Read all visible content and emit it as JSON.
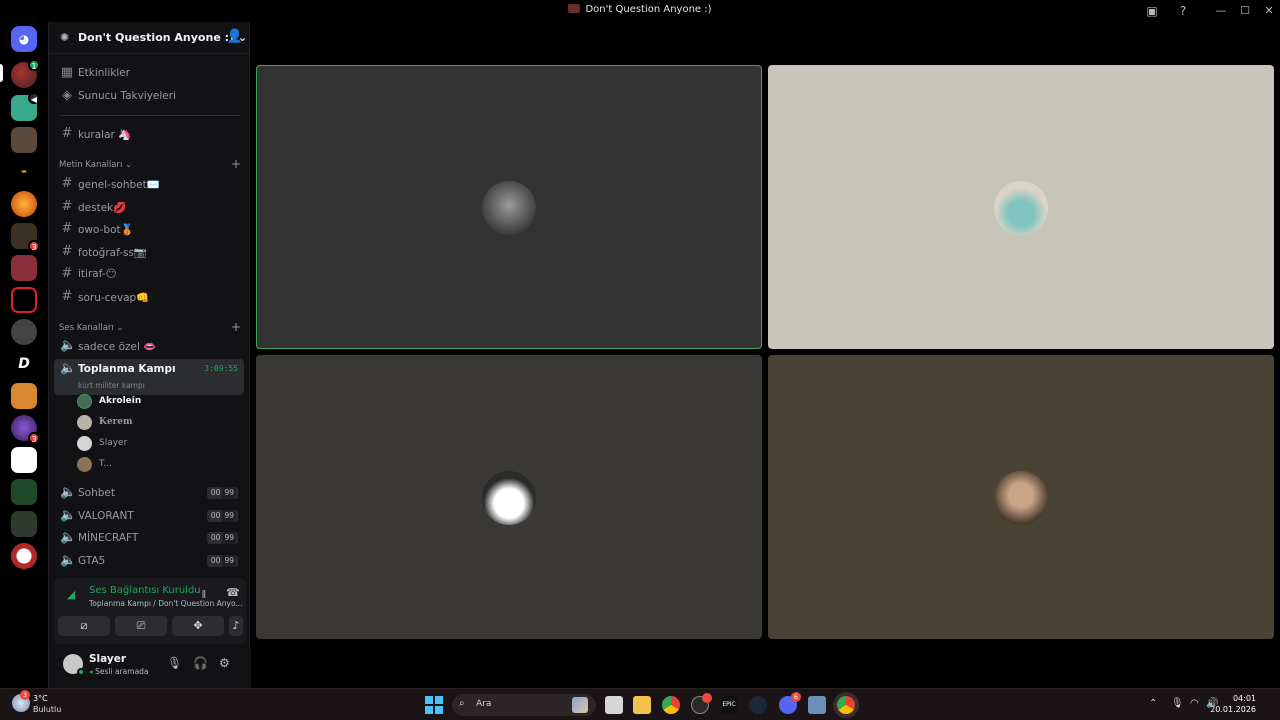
{
  "window": {
    "title": "Don't Question Anyone :)",
    "icons": [
      "inbox-icon",
      "help-icon",
      "minimize-icon",
      "maximize-icon",
      "close-icon"
    ]
  },
  "rail": {
    "badges": {
      "pill_server_badge": "1",
      "server_8": "3",
      "server_14": "3"
    }
  },
  "server": {
    "name": "Don't Question Anyone :)",
    "top_items": [
      {
        "label": "Etkinlikler"
      },
      {
        "label": "Sunucu Takviyeleri"
      }
    ],
    "rules_channel": "kuralar 🦄",
    "text_category": "Metin Kanalları",
    "text_channels": [
      {
        "label": "genel-sohbet✉️"
      },
      {
        "label": "destek💋"
      },
      {
        "label": "owo-bot🥉"
      },
      {
        "label": "fotoğraf-ss📷"
      },
      {
        "label": "itiraf-😶"
      },
      {
        "label": "soru-cevap👊"
      }
    ],
    "voice_category": "Ses Kanalları",
    "voice_channels": {
      "sadece": {
        "label": "sadece özel 👄"
      },
      "active": {
        "label": "Toplanma Kampı",
        "timer": "3:09:55",
        "status": "kürt militer kampı"
      },
      "users": [
        {
          "name": "Akrolein"
        },
        {
          "name": "𝐊𝐞𝐫𝐞𝐦"
        },
        {
          "name": "Slayer"
        },
        {
          "name": "T..."
        }
      ],
      "others": [
        {
          "label": "Sohbet",
          "count_left": "00",
          "count_right": "99"
        },
        {
          "label": "VALORANT",
          "count_left": "00",
          "count_right": "99"
        },
        {
          "label": "MİNECRAFT",
          "count_left": "00",
          "count_right": "99"
        },
        {
          "label": "GTA5",
          "count_left": "00",
          "count_right": "99"
        }
      ]
    }
  },
  "voice_panel": {
    "status": "Ses Bağlantısı Kuruldu",
    "location": "Toplanma Kampı / Don't Question Anyo..."
  },
  "user": {
    "name": "Slayer",
    "status": "Sesli aramada"
  },
  "taskbar": {
    "weather_temp": "3°C",
    "weather_desc": "Bulutlu",
    "search_placeholder": "Ara",
    "time": "04:01",
    "date": "20.01.2026",
    "badge_discord": "6"
  }
}
